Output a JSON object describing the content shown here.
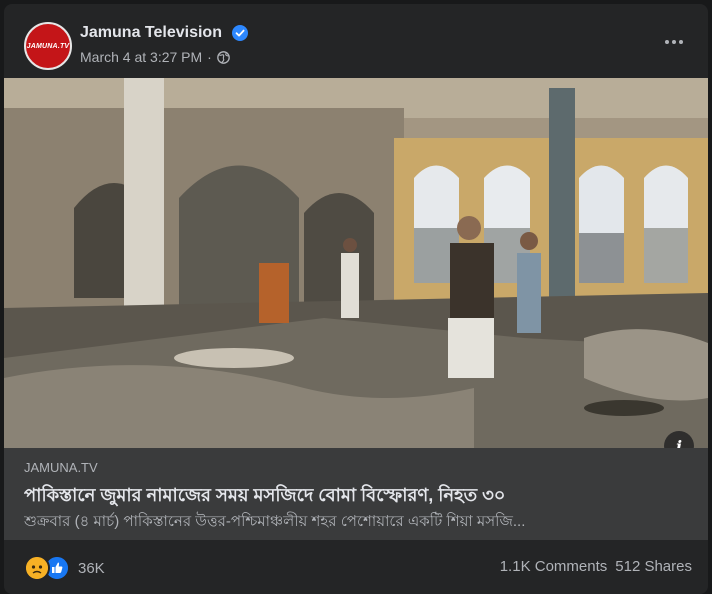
{
  "post": {
    "page_name": "Jamuna Television",
    "timestamp": "March 4 at 3:27 PM",
    "separator": "·",
    "avatar_label": "JAMUNA.TV",
    "privacy_icon": "globe-icon",
    "verified_icon": "verified-badge-icon"
  },
  "link": {
    "domain": "JAMUNA.TV",
    "headline": "পাকিস্তানে জুমার নামাজের সময় মসজিদে বোমা বিস্ফোরণ, নিহত ৩০",
    "description": "শুক্রবার (৪ মার্চ) পাকিস্তানের উত্তর-পশ্চিমাঞ্চলীয় শহর পেশোয়ারে একটি শিয়া মসজি..."
  },
  "footer": {
    "reaction_count": "36K",
    "comments": "1.1K Comments",
    "shares": "512 Shares",
    "reaction_icons": [
      "sad-reaction-icon",
      "like-reaction-icon"
    ]
  },
  "colors": {
    "background": "#242526",
    "link_box": "#3a3b3c",
    "verified": "#2d88ff",
    "brand_red": "#c41518"
  }
}
